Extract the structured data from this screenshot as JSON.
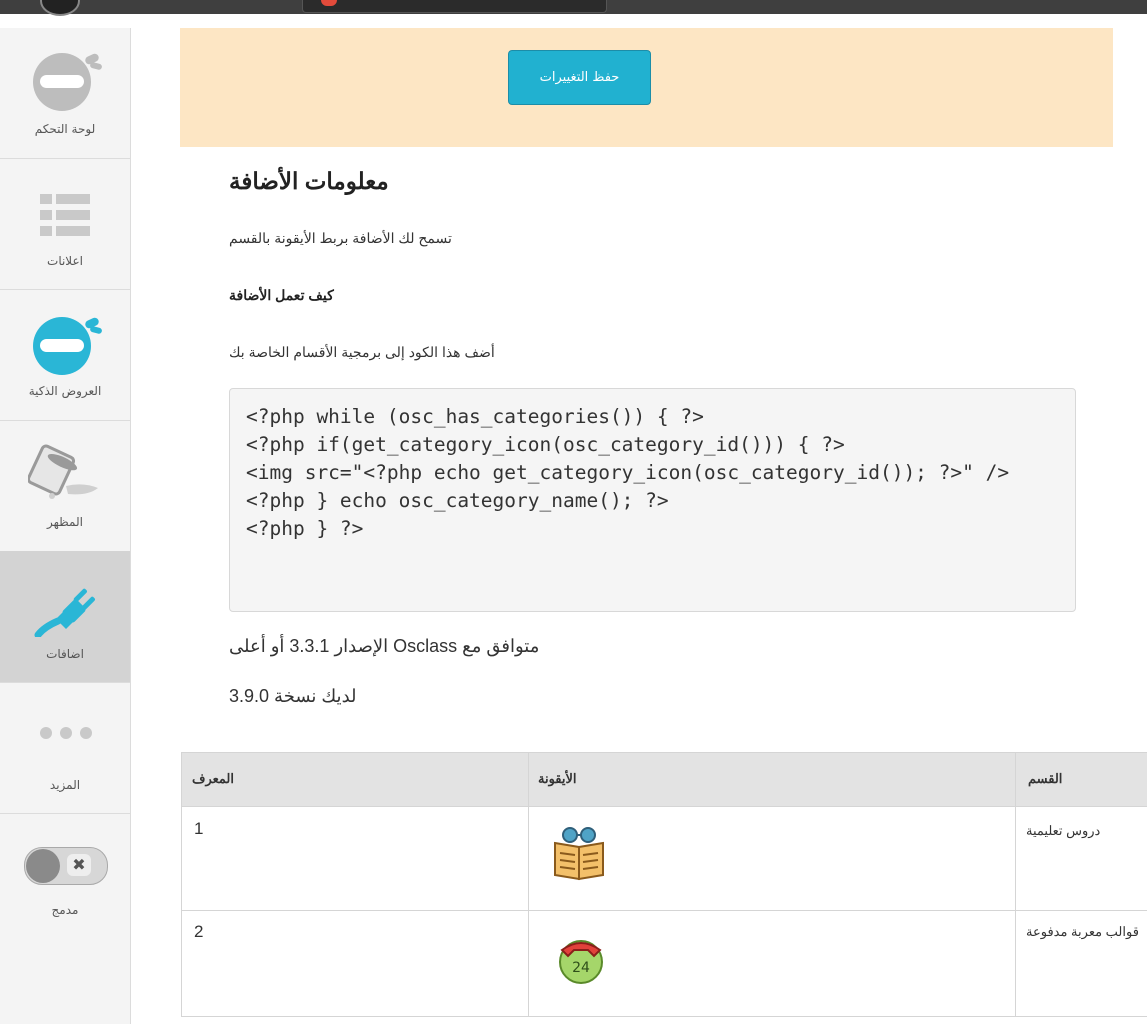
{
  "sidebar": {
    "items": [
      {
        "label": "لوحة التحكم",
        "icon": "dashboard-ninja-icon"
      },
      {
        "label": "اعلانات",
        "icon": "listings-icon"
      },
      {
        "label": "العروض الذكية",
        "icon": "smart-offers-ninja-icon"
      },
      {
        "label": "المظهر",
        "icon": "appearance-paint-icon"
      },
      {
        "label": "اضافات",
        "icon": "plugins-plug-icon"
      },
      {
        "label": "المزيد",
        "icon": "more-dots-icon"
      },
      {
        "label": "مدمج",
        "icon": "compact-toggle-icon"
      }
    ]
  },
  "banner": {
    "save_label": "حفظ التغييرات"
  },
  "info": {
    "title": "معلومات الأضافة",
    "description": "تسمح لك الأضافة بربط الأيقونة بالقسم",
    "how_title": "كيف تعمل الأضافة",
    "how_description": "أضف هذا الكود إلى برمجية الأقسام الخاصة بك",
    "code": "<?php while (osc_has_categories()) { ?>\n<?php if(get_category_icon(osc_category_id())) { ?>\n<img src=\"<?php echo get_category_icon(osc_category_id()); ?>\" />\n<?php } echo osc_category_name(); ?>\n<?php } ?>",
    "compat": "الإصدار 3.3.1 أو أعلى Osclass متوافق مع",
    "version": "لديك نسخة 3.9.0"
  },
  "table": {
    "headers": {
      "id": "المعرف",
      "icon": "الأيقونة",
      "category": "القسم"
    },
    "rows": [
      {
        "id": "1",
        "icon": "book-icon",
        "category": "دروس تعليمية"
      },
      {
        "id": "2",
        "icon": "phone-24-icon",
        "category": "قوالب معربة مدفوعة"
      }
    ]
  },
  "colors": {
    "accent": "#21b1d0",
    "banner": "#fde6c4",
    "ninja_active": "#2ab6d6"
  }
}
